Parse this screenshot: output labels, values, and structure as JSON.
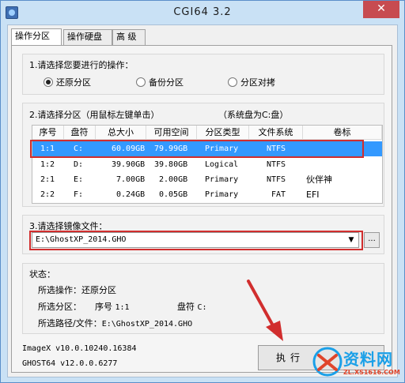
{
  "window": {
    "title": "CGI64  3.2",
    "close_glyph": "✕"
  },
  "tabs": [
    "操作分区",
    "操作硬盘",
    "高 级"
  ],
  "operation_group": {
    "label": "1.请选择您要进行的操作：",
    "options": [
      {
        "label": "还原分区",
        "selected": true
      },
      {
        "label": "备份分区",
        "selected": false
      },
      {
        "label": "分区对拷",
        "selected": false
      }
    ]
  },
  "partition_group": {
    "label": "2.请选择分区（用鼠标左键单击）",
    "system_disk_note": "（系统盘为C:盘）",
    "columns": [
      "序号",
      "盘符",
      "总大小",
      "可用空间",
      "分区类型",
      "文件系统",
      "卷标"
    ],
    "rows": [
      {
        "index": "1:1",
        "drive": "C:",
        "total": "60.09GB",
        "free": "79.99GB",
        "type": "Primary",
        "fs": "NTFS",
        "label": "",
        "selected": true
      },
      {
        "index": "1:2",
        "drive": "D:",
        "total": "39.90GB",
        "free": "39.80GB",
        "type": "Logical",
        "fs": "NTFS",
        "label": "",
        "selected": false
      },
      {
        "index": "2:1",
        "drive": "E:",
        "total": "7.00GB",
        "free": "2.00GB",
        "type": "Primary",
        "fs": "NTFS",
        "label": "伙伴神",
        "selected": false
      },
      {
        "index": "2:2",
        "drive": "F:",
        "total": "0.24GB",
        "free": "0.05GB",
        "type": "Primary",
        "fs": "FAT",
        "label": "EFI",
        "selected": false
      }
    ]
  },
  "image_group": {
    "label": "3.请选择镜像文件：",
    "value": "E:\\GhostXP_2014.GHO",
    "arrow_glyph": "▼",
    "browse_label": "..."
  },
  "status": {
    "label": "状态：",
    "operation_label": "所选操作：",
    "operation_value": "还原分区",
    "partition_label": "所选分区：",
    "index_label": "序号",
    "index_value": "1:1",
    "drive_label": "盘符",
    "drive_value": "C:",
    "path_label": "所选路径/文件：",
    "path_value": "E:\\GhostXP_2014.GHO"
  },
  "footer": {
    "imagex_version": "ImageX v10.0.10240.16384",
    "ghost_version": "GHOST64 v12.0.0.6277",
    "execute_label": "执行"
  },
  "watermark": {
    "title": "资料网",
    "url": "ZL.XS1616.COM"
  },
  "colors": {
    "selection": "#3399ff",
    "highlight_box": "#d12e2e",
    "close_button": "#c74b50",
    "watermark_blue": "#1aa0e8",
    "watermark_red": "#e0452b"
  }
}
